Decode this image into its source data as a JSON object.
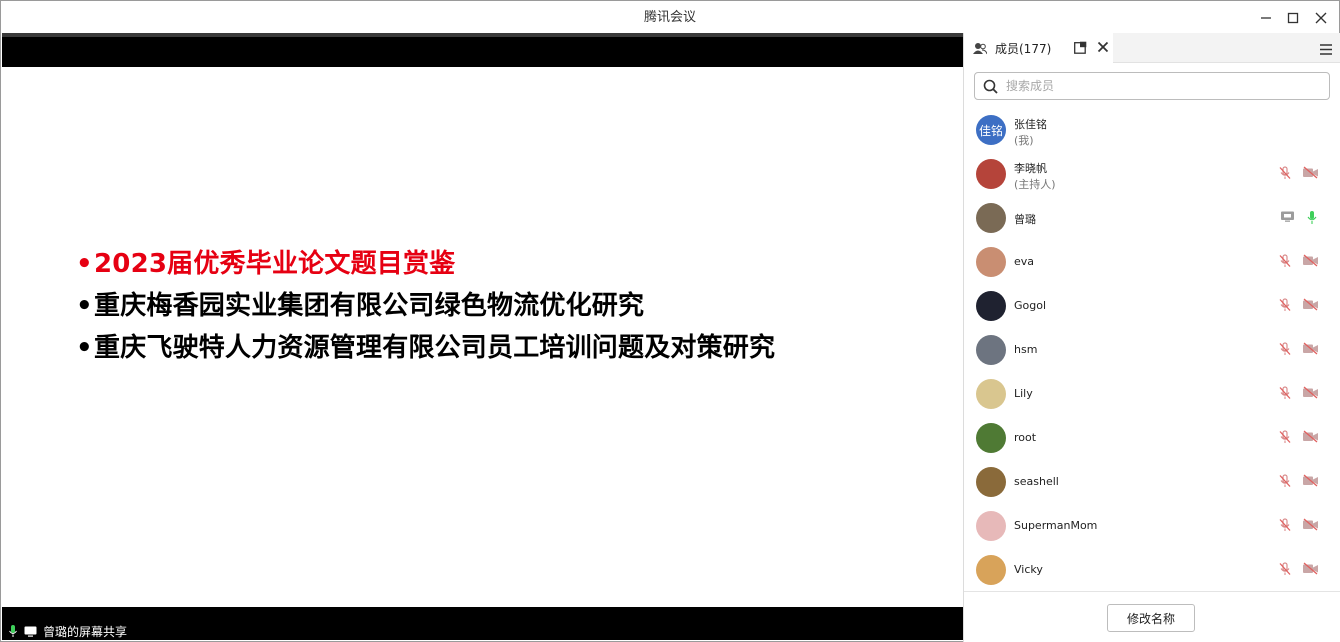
{
  "window": {
    "title": "腾讯会议"
  },
  "slide": {
    "bullet_symbol": "•",
    "bullets": [
      "2023届优秀毕业论文题目赏鉴",
      "重庆梅香园实业集团有限公司绿色物流优化研究",
      "重庆飞驶特人力资源管理有限公司员工培训问题及对策研究"
    ],
    "highlight_color": "#e60012"
  },
  "share_status": {
    "label": "曾璐的屏幕共享"
  },
  "panel": {
    "tab_label": "成员(177)",
    "search_placeholder": "搜索成员",
    "rename_button": "修改名称"
  },
  "members": [
    {
      "name": "张佳铭",
      "sub": "(我)",
      "avatar_text": "佳铭",
      "avatar_color": "#3d6fc4",
      "mic": "none",
      "video": "none"
    },
    {
      "name": "李晓帆",
      "sub": "(主持人)",
      "avatar_text": "",
      "avatar_color": "#b5443a",
      "mic": "muted",
      "video": "off"
    },
    {
      "name": "曾璐",
      "sub": "",
      "avatar_text": "",
      "avatar_color": "#7a6a55",
      "mic": "active",
      "video": "screen"
    },
    {
      "name": "eva",
      "sub": "",
      "avatar_text": "",
      "avatar_color": "#c98e72",
      "mic": "muted",
      "video": "off"
    },
    {
      "name": "Gogol",
      "sub": "",
      "avatar_text": "",
      "avatar_color": "#1f2230",
      "mic": "muted",
      "video": "off"
    },
    {
      "name": "hsm",
      "sub": "",
      "avatar_text": "",
      "avatar_color": "#6d7480",
      "mic": "muted",
      "video": "off"
    },
    {
      "name": "Lily",
      "sub": "",
      "avatar_text": "",
      "avatar_color": "#d9c68f",
      "mic": "muted",
      "video": "off"
    },
    {
      "name": "root",
      "sub": "",
      "avatar_text": "",
      "avatar_color": "#4f7a34",
      "mic": "muted",
      "video": "off"
    },
    {
      "name": "seashell",
      "sub": "",
      "avatar_text": "",
      "avatar_color": "#8a6a3a",
      "mic": "muted",
      "video": "off"
    },
    {
      "name": "SupermanMom",
      "sub": "",
      "avatar_text": "",
      "avatar_color": "#e7b9b9",
      "mic": "muted",
      "video": "off"
    },
    {
      "name": "Vicky",
      "sub": "",
      "avatar_text": "",
      "avatar_color": "#d8a35a",
      "mic": "muted",
      "video": "off"
    }
  ]
}
